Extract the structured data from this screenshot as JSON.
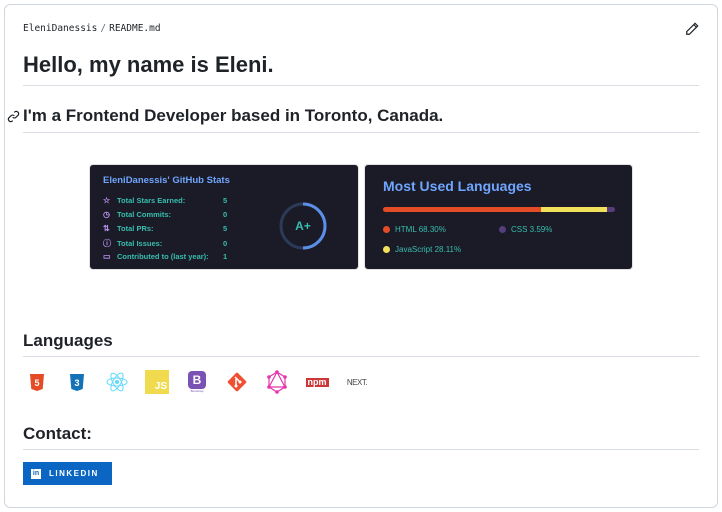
{
  "breadcrumb": {
    "user": "EleniDanessis",
    "sep": "/",
    "file": "README.md"
  },
  "heading": "Hello, my name is Eleni.",
  "subheading": "I'm a Frontend Developer based in Toronto, Canada.",
  "stats": {
    "title": "EleniDanessis' GitHub Stats",
    "rows": [
      {
        "label": "Total Stars Earned:",
        "value": "5",
        "icon": "star-icon"
      },
      {
        "label": "Total Commits:",
        "value": "0",
        "icon": "clock-icon"
      },
      {
        "label": "Total PRs:",
        "value": "5",
        "icon": "pull-request-icon"
      },
      {
        "label": "Total Issues:",
        "value": "0",
        "icon": "issue-icon"
      },
      {
        "label": "Contributed to (last year):",
        "value": "1",
        "icon": "repo-icon"
      }
    ],
    "grade": "A+"
  },
  "languages_card": {
    "title": "Most Used Languages",
    "items": [
      {
        "name": "HTML",
        "percent": 68.3,
        "label": "HTML 68.30%",
        "color": "#e34c26"
      },
      {
        "name": "JavaScript",
        "percent": 28.11,
        "label": "JavaScript 28.11%",
        "color": "#f1e05a"
      },
      {
        "name": "CSS",
        "percent": 3.59,
        "label": "CSS 3.59%",
        "color": "#563d7c"
      }
    ]
  },
  "languages_heading": "Languages",
  "tech_icons": [
    "html5",
    "css3",
    "react",
    "javascript",
    "bootstrap",
    "git",
    "graphql",
    "npm",
    "nextjs"
  ],
  "tech_labels": {
    "html": "HTML",
    "css": "CSS",
    "js": "JS",
    "b": "B",
    "bootstrap": "Bootstrap",
    "npm": "npm",
    "next": "NEXT."
  },
  "contact_heading": "Contact:",
  "linkedin": {
    "label": "LINKEDIN",
    "icon": "in"
  }
}
